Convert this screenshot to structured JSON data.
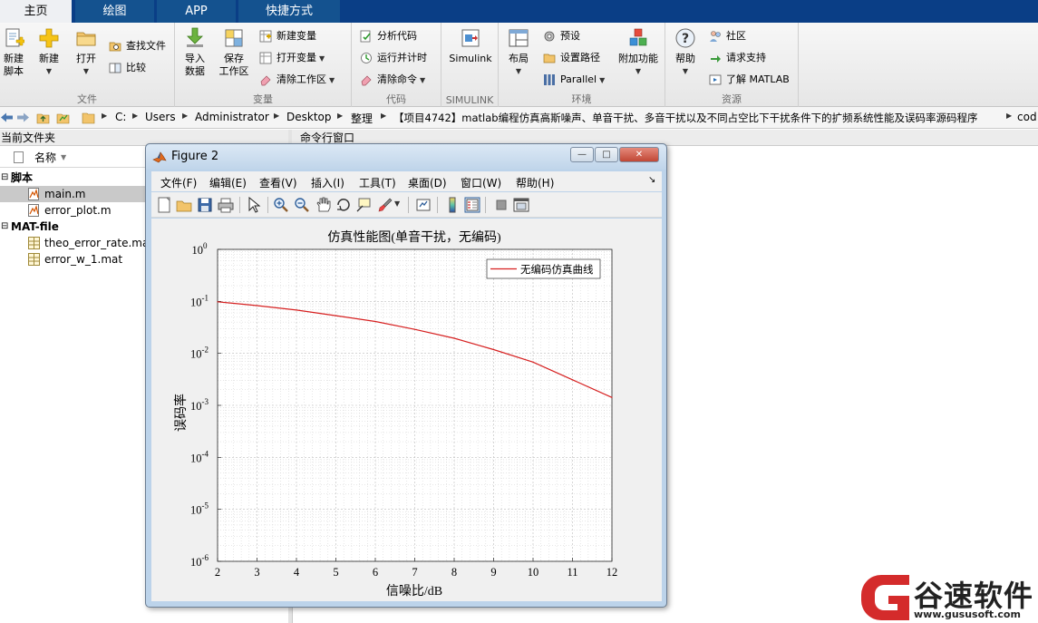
{
  "tabs": [
    {
      "label": "主页",
      "active": true
    },
    {
      "label": "绘图",
      "active": false
    },
    {
      "label": "APP",
      "active": false
    },
    {
      "label": "快捷方式",
      "active": false
    }
  ],
  "ribbon": {
    "file": {
      "title": "文件",
      "new_script": [
        "新建",
        "脚本"
      ],
      "new": "新建",
      "open": "打开",
      "find_files": "查找文件",
      "compare": "比较"
    },
    "variable": {
      "title": "变量",
      "import": [
        "导入",
        "数据"
      ],
      "save_ws": [
        "保存",
        "工作区"
      ],
      "new_var": "新建变量",
      "open_var": "打开变量",
      "clear_ws": "清除工作区"
    },
    "code": {
      "title": "代码",
      "analyze": "分析代码",
      "run_time": "运行并计时",
      "clear_cmds": "清除命令"
    },
    "simulink": {
      "title": "SIMULINK",
      "label": "Simulink"
    },
    "environment": {
      "title": "环境",
      "layout": "布局",
      "prefs": "预设",
      "set_path": "设置路径",
      "parallel": "Parallel",
      "addons": "附加功能"
    },
    "resources": {
      "title": "资源",
      "help": "帮助",
      "community": "社区",
      "request_support": "请求支持",
      "learn_matlab": "了解 MATLAB"
    }
  },
  "addressbar": {
    "crumbs": [
      "C:",
      "Users",
      "Administrator",
      "Desktop",
      "整理",
      "【项目4742】matlab编程仿真高斯噪声、单音干扰、多音干扰以及不同占空比下干扰条件下的扩频系统性能及误码率源码程序",
      "cod"
    ]
  },
  "current_folder": {
    "header": "当前文件夹",
    "name_col": "名称",
    "groups": [
      {
        "title": "脚本",
        "files": [
          "main.m",
          "error_plot.m"
        ]
      },
      {
        "title": "MAT-file",
        "files": [
          "theo_error_rate.mat",
          "error_w_1.mat"
        ]
      }
    ],
    "selected": "main.m"
  },
  "command_window": {
    "header": "命令行窗口"
  },
  "figure": {
    "title": "Figure 2",
    "minimize": "—",
    "maximize": "□",
    "close": "✕",
    "menus": [
      "文件(F)",
      "编辑(E)",
      "查看(V)",
      "插入(I)",
      "工具(T)",
      "桌面(D)",
      "窗口(W)",
      "帮助(H)"
    ],
    "menu_overflow": "↘",
    "toolbar_icons": [
      "new-figure-icon",
      "open-file-icon",
      "save-icon",
      "print-icon",
      "pointer-icon",
      "zoom-in-icon",
      "zoom-out-icon",
      "pan-icon",
      "rotate-icon",
      "data-cursor-icon",
      "brush-icon",
      "link-icon",
      "colorbar-icon",
      "legend-icon",
      "hide-plot-tools-icon",
      "show-plot-tools-icon"
    ]
  },
  "chart_data": {
    "type": "line",
    "title": "仿真性能图(单音干扰，无编码)",
    "xlabel": "信噪比/dB",
    "ylabel": "误码率",
    "xlim": [
      2,
      12
    ],
    "ylim": [
      1e-06,
      1
    ],
    "yscale": "log",
    "grid": true,
    "legend_position": "top-right",
    "x_ticks": [
      "2",
      "3",
      "4",
      "5",
      "6",
      "7",
      "8",
      "9",
      "10",
      "11",
      "12"
    ],
    "y_ticks": [
      {
        "base": "10",
        "exp": "0",
        "value": 1
      },
      {
        "base": "10",
        "exp": "-1",
        "value": 0.1
      },
      {
        "base": "10",
        "exp": "-2",
        "value": 0.01
      },
      {
        "base": "10",
        "exp": "-3",
        "value": 0.001
      },
      {
        "base": "10",
        "exp": "-4",
        "value": 0.0001
      },
      {
        "base": "10",
        "exp": "-5",
        "value": 1e-05
      },
      {
        "base": "10",
        "exp": "-6",
        "value": 1e-06
      }
    ],
    "series": [
      {
        "name": "无编码仿真曲线",
        "color": "#d62020",
        "x": [
          2,
          3,
          4,
          5,
          6,
          7,
          8,
          9,
          10,
          11,
          12
        ],
        "y": [
          0.098,
          0.083,
          0.068,
          0.053,
          0.041,
          0.029,
          0.0195,
          0.0118,
          0.0068,
          0.0031,
          0.00142
        ]
      }
    ]
  },
  "watermark": {
    "text": "谷速软件",
    "url": "www.gususoft.com",
    "color": "#d42b2b"
  }
}
